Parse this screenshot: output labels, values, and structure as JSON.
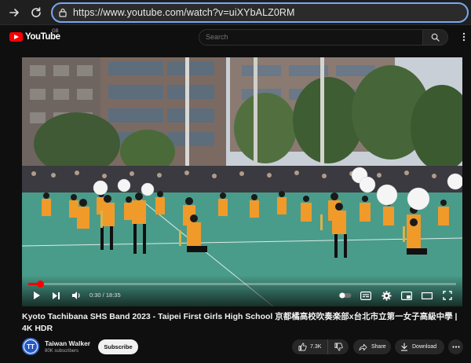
{
  "browser": {
    "url": "https://www.youtube.com/watch?v=uiXYbALZ0RM"
  },
  "header": {
    "logo_text": "YouTube",
    "region": "GB",
    "search_placeholder": "Search"
  },
  "player": {
    "current_time": "0:30",
    "duration": "18:35",
    "time_display": "0:30 / 18:35",
    "progress": 0.027
  },
  "video": {
    "title": "Kyoto Tachibana SHS Band 2023 - Taipei First Girls High School 京都橘高校吹奏楽部x台北市立第一女子高級中學 | 4K HDR"
  },
  "channel": {
    "avatar_text": "TT",
    "name": "Taiwan Walker",
    "subscribers": "80K subscribers",
    "subscribe_label": "Subscribe"
  },
  "actions": {
    "likes": "7.3K",
    "share_label": "Share",
    "download_label": "Download"
  },
  "colors": {
    "accent": "#ff0000",
    "url_focus": "#7aa7f2",
    "background": "#0f0f0f"
  }
}
